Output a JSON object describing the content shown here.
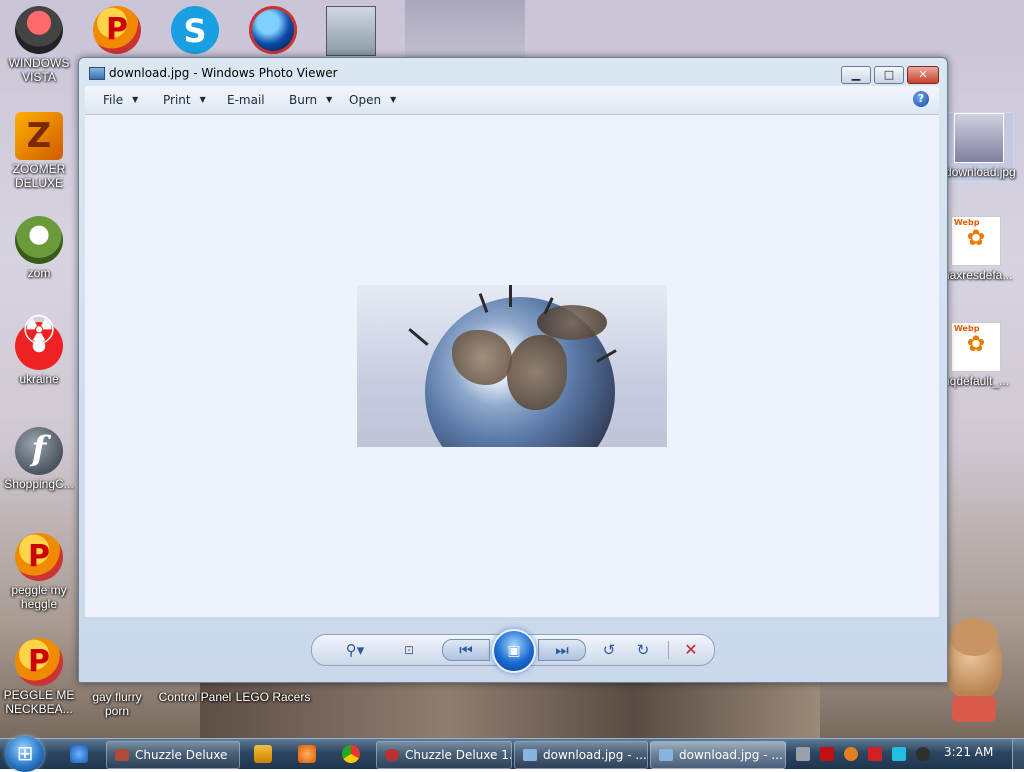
{
  "desktop": {
    "icons": [
      {
        "label": "WINDOWS VISTA",
        "icon": "vista-icon"
      },
      {
        "label": "",
        "icon": "peggle-icon"
      },
      {
        "label": "",
        "icon": "skype-icon"
      },
      {
        "label": "",
        "icon": "globe-browser-icon"
      },
      {
        "label": "",
        "icon": "network-computer-icon"
      },
      {
        "label": "ZOOMER DELUXE",
        "icon": "zoomer-icon"
      },
      {
        "label": "zom",
        "icon": "zombie-plant-icon"
      },
      {
        "label": "ukraine",
        "icon": "radiation-icon"
      },
      {
        "label": "ShoppingC...",
        "icon": "flash-icon"
      },
      {
        "label": "peggle my heggle",
        "icon": "peggle-icon"
      },
      {
        "label": "PEGGLE ME NECKBEA...",
        "icon": "peggle-icon"
      },
      {
        "label": "gay flurry porn",
        "icon": "folder-icon"
      },
      {
        "label": "Control Panel",
        "icon": "control-panel-icon"
      },
      {
        "label": "LEGO Racers",
        "icon": "lego-icon"
      },
      {
        "label": "download.jpg",
        "icon": "image-file-icon"
      },
      {
        "label": "maxresdefa...",
        "icon": "webp-file-icon"
      },
      {
        "label": "hqdefault_...",
        "icon": "webp-file-icon"
      }
    ]
  },
  "window": {
    "title": "download.jpg - Windows Photo Viewer",
    "caption": {
      "minimize": "▁",
      "maximize": "□",
      "close": "✕"
    },
    "menu": [
      {
        "label": "File",
        "dropdown": true
      },
      {
        "label": "Print",
        "dropdown": true
      },
      {
        "label": "E-mail",
        "dropdown": false
      },
      {
        "label": "Burn",
        "dropdown": true
      },
      {
        "label": "Open",
        "dropdown": true
      }
    ],
    "help": "?",
    "controls": {
      "zoom": "⚲▾",
      "fit": "⊡",
      "prev": "⏮",
      "play": "▣",
      "next": "⏭",
      "rotate_left": "↺",
      "rotate_right": "↻",
      "delete": "✕"
    }
  },
  "taskbar": {
    "buttons": [
      {
        "label": "Chuzzle Deluxe",
        "active": false
      },
      {
        "label": "Chuzzle Deluxe 1...",
        "active": false
      },
      {
        "label": "download.jpg - ...",
        "active": false
      },
      {
        "label": "download.jpg - ...",
        "active": true
      }
    ],
    "clock": "3:21 AM"
  },
  "colors": {
    "accent": "#2a5aa0",
    "delete": "#c8202a",
    "taskbar": "#2d4660"
  }
}
